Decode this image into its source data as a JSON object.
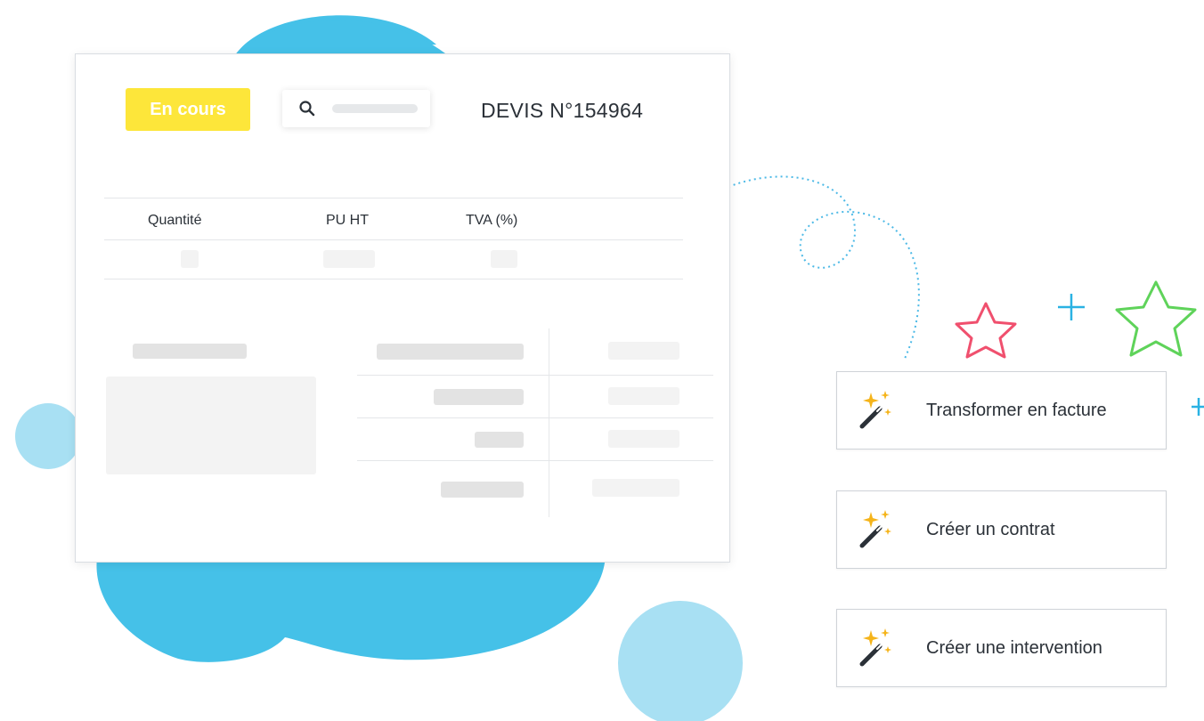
{
  "quote": {
    "status_label": "En cours",
    "title": "DEVIS N°154964",
    "columns": [
      "Quantité",
      "PU HT",
      "TVA (%)"
    ]
  },
  "actions": [
    {
      "label": "Transformer en facture",
      "icon": "magic-wand-icon"
    },
    {
      "label": "Créer un contrat",
      "icon": "magic-wand-icon"
    },
    {
      "label": "Créer une intervention",
      "icon": "magic-wand-icon"
    }
  ],
  "colors": {
    "status_yellow": "#fde63a",
    "blob_blue": "#45c1e8",
    "light_blue": "#a8e0f3",
    "star_pink": "#f0506e",
    "star_green": "#5fd35a",
    "plus_blue": "#2ab2e3"
  }
}
